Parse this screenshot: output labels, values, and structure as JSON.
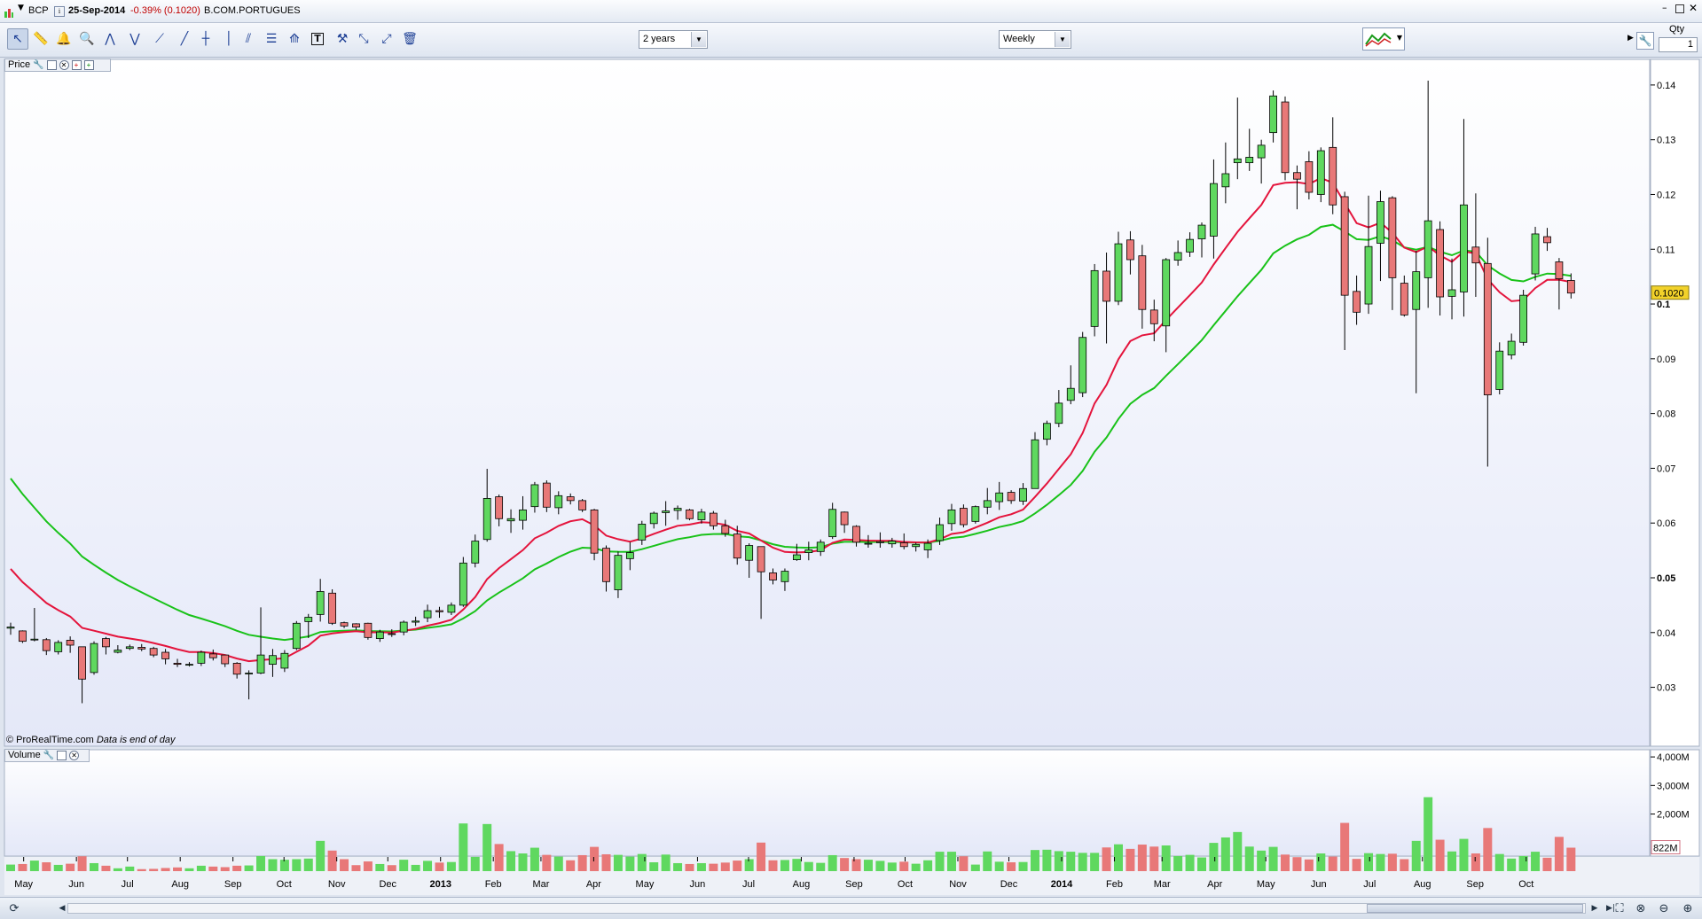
{
  "window": {
    "symbol": "BCP",
    "date": "25-Sep-2014",
    "change": "-0.39% (0.1020)",
    "name": "B.COM.PORTUGUES"
  },
  "toolbar": {
    "period": "2 years",
    "interval": "Weekly",
    "qty_label": "Qty",
    "qty_value": "1",
    "icons": [
      "pointer-icon",
      "ruler-icon",
      "alarm-bell-icon",
      "zoom-icon",
      "pattern-icon",
      "trend-pattern-icon",
      "trendline-icon",
      "line-icon",
      "horizontal-line-icon",
      "vertical-line-icon",
      "fibonacci-icon",
      "channel-icon",
      "regression-icon",
      "text-tool-icon",
      "hammer-icon",
      "extend-line-icon",
      "ray-icon",
      "trash-icon"
    ]
  },
  "price_panel": {
    "label": "Price",
    "credit": "© ProRealTime.com",
    "credit_note": "Data is end of day",
    "last_price_tag": "0.1020",
    "y_ticks": [
      "0.14",
      "0.13",
      "0.12",
      "0.11",
      "0.1",
      "0.09",
      "0.08",
      "0.07",
      "0.06",
      "0.05",
      "0.04",
      "0.03"
    ],
    "bold_ticks": [
      "0.1",
      "0.05"
    ]
  },
  "volume_panel": {
    "label": "Volume",
    "y_ticks": [
      "4,000M",
      "3,000M",
      "2,000M"
    ],
    "last_volume_tag": "822M"
  },
  "x_axis": {
    "labels": [
      "May",
      "Jun",
      "Jul",
      "Aug",
      "Sep",
      "Oct",
      "Nov",
      "Dec",
      "2013",
      "Feb",
      "Mar",
      "Apr",
      "May",
      "Jun",
      "Jul",
      "Aug",
      "Sep",
      "Oct",
      "Nov",
      "Dec",
      "2014",
      "Feb",
      "Mar",
      "Apr",
      "May",
      "Jun",
      "Jul",
      "Aug",
      "Sep",
      "Oct"
    ],
    "bold_labels": [
      "2013",
      "2014"
    ]
  },
  "colors": {
    "up": "#5fd85f",
    "down": "#e87878",
    "ma_short": "#e4143c",
    "ma_long": "#19c219",
    "background_top": "#ffffff",
    "background_bottom": "#e6eaf8",
    "tag": "#f2d22a"
  },
  "chart_data": {
    "type": "candlestick",
    "interval": "weekly",
    "ylim": [
      0.022,
      0.145
    ],
    "volume_ylim": [
      0,
      4500
    ],
    "volume_unit": "M",
    "x_start": "2012-04-27",
    "candles": [
      {
        "o": 0.0408,
        "h": 0.0418,
        "l": 0.0396,
        "c": 0.041,
        "v": 230
      },
      {
        "o": 0.0403,
        "h": 0.0404,
        "l": 0.0381,
        "c": 0.0384,
        "v": 250
      },
      {
        "o": 0.0388,
        "h": 0.0445,
        "l": 0.0384,
        "c": 0.0388,
        "v": 370
      },
      {
        "o": 0.0387,
        "h": 0.039,
        "l": 0.0359,
        "c": 0.0367,
        "v": 310
      },
      {
        "o": 0.0365,
        "h": 0.0386,
        "l": 0.036,
        "c": 0.0382,
        "v": 220
      },
      {
        "o": 0.0386,
        "h": 0.0393,
        "l": 0.0363,
        "c": 0.0377,
        "v": 260
      },
      {
        "o": 0.0374,
        "h": 0.0374,
        "l": 0.0271,
        "c": 0.0315,
        "v": 520
      },
      {
        "o": 0.0327,
        "h": 0.0384,
        "l": 0.0323,
        "c": 0.038,
        "v": 280
      },
      {
        "o": 0.0389,
        "h": 0.0392,
        "l": 0.036,
        "c": 0.0374,
        "v": 190
      },
      {
        "o": 0.0364,
        "h": 0.0377,
        "l": 0.0362,
        "c": 0.0368,
        "v": 100
      },
      {
        "o": 0.0371,
        "h": 0.0378,
        "l": 0.0368,
        "c": 0.0374,
        "v": 160
      },
      {
        "o": 0.0373,
        "h": 0.0379,
        "l": 0.0366,
        "c": 0.037,
        "v": 70
      },
      {
        "o": 0.0371,
        "h": 0.0374,
        "l": 0.0355,
        "c": 0.0359,
        "v": 80
      },
      {
        "o": 0.0364,
        "h": 0.037,
        "l": 0.0342,
        "c": 0.0352,
        "v": 110
      },
      {
        "o": 0.0344,
        "h": 0.0352,
        "l": 0.0337,
        "c": 0.0342,
        "v": 130
      },
      {
        "o": 0.0342,
        "h": 0.0346,
        "l": 0.0338,
        "c": 0.0342,
        "v": 100
      },
      {
        "o": 0.0344,
        "h": 0.0367,
        "l": 0.0339,
        "c": 0.0364,
        "v": 190
      },
      {
        "o": 0.0361,
        "h": 0.0369,
        "l": 0.0349,
        "c": 0.0354,
        "v": 160
      },
      {
        "o": 0.0359,
        "h": 0.0359,
        "l": 0.0337,
        "c": 0.0343,
        "v": 140
      },
      {
        "o": 0.0344,
        "h": 0.0346,
        "l": 0.0316,
        "c": 0.0324,
        "v": 190
      },
      {
        "o": 0.0325,
        "h": 0.0331,
        "l": 0.0278,
        "c": 0.0326,
        "v": 200
      },
      {
        "o": 0.0326,
        "h": 0.0446,
        "l": 0.0324,
        "c": 0.0359,
        "v": 530
      },
      {
        "o": 0.0342,
        "h": 0.037,
        "l": 0.0319,
        "c": 0.0358,
        "v": 420
      },
      {
        "o": 0.0335,
        "h": 0.0368,
        "l": 0.0328,
        "c": 0.0362,
        "v": 400
      },
      {
        "o": 0.0371,
        "h": 0.0421,
        "l": 0.0368,
        "c": 0.0417,
        "v": 420
      },
      {
        "o": 0.042,
        "h": 0.0434,
        "l": 0.039,
        "c": 0.0428,
        "v": 440
      },
      {
        "o": 0.0433,
        "h": 0.0498,
        "l": 0.042,
        "c": 0.0475,
        "v": 1060
      },
      {
        "o": 0.0472,
        "h": 0.0479,
        "l": 0.0414,
        "c": 0.0417,
        "v": 720
      },
      {
        "o": 0.0418,
        "h": 0.042,
        "l": 0.0408,
        "c": 0.0412,
        "v": 420
      },
      {
        "o": 0.0416,
        "h": 0.0417,
        "l": 0.0405,
        "c": 0.041,
        "v": 210
      },
      {
        "o": 0.0417,
        "h": 0.0418,
        "l": 0.0387,
        "c": 0.0391,
        "v": 340
      },
      {
        "o": 0.0389,
        "h": 0.0405,
        "l": 0.0383,
        "c": 0.0401,
        "v": 250
      },
      {
        "o": 0.0398,
        "h": 0.0406,
        "l": 0.0392,
        "c": 0.0397,
        "v": 210
      },
      {
        "o": 0.0401,
        "h": 0.0422,
        "l": 0.0395,
        "c": 0.0419,
        "v": 400
      },
      {
        "o": 0.0419,
        "h": 0.0429,
        "l": 0.0412,
        "c": 0.0421,
        "v": 220
      },
      {
        "o": 0.0427,
        "h": 0.0451,
        "l": 0.0419,
        "c": 0.044,
        "v": 360
      },
      {
        "o": 0.044,
        "h": 0.0447,
        "l": 0.0427,
        "c": 0.0438,
        "v": 300
      },
      {
        "o": 0.0437,
        "h": 0.0455,
        "l": 0.0432,
        "c": 0.045,
        "v": 320
      },
      {
        "o": 0.045,
        "h": 0.0538,
        "l": 0.0447,
        "c": 0.0527,
        "v": 1670
      },
      {
        "o": 0.0527,
        "h": 0.0579,
        "l": 0.0519,
        "c": 0.0567,
        "v": 500
      },
      {
        "o": 0.057,
        "h": 0.0699,
        "l": 0.0566,
        "c": 0.0645,
        "v": 1650
      },
      {
        "o": 0.0648,
        "h": 0.0652,
        "l": 0.0594,
        "c": 0.0608,
        "v": 950
      },
      {
        "o": 0.0604,
        "h": 0.0625,
        "l": 0.0582,
        "c": 0.0608,
        "v": 700
      },
      {
        "o": 0.0605,
        "h": 0.0649,
        "l": 0.0588,
        "c": 0.0624,
        "v": 620
      },
      {
        "o": 0.063,
        "h": 0.0675,
        "l": 0.0619,
        "c": 0.067,
        "v": 820
      },
      {
        "o": 0.0673,
        "h": 0.0678,
        "l": 0.062,
        "c": 0.0629,
        "v": 570
      },
      {
        "o": 0.0628,
        "h": 0.0658,
        "l": 0.0616,
        "c": 0.065,
        "v": 510
      },
      {
        "o": 0.0648,
        "h": 0.0654,
        "l": 0.0634,
        "c": 0.0641,
        "v": 380
      },
      {
        "o": 0.0641,
        "h": 0.0644,
        "l": 0.062,
        "c": 0.0624,
        "v": 560
      },
      {
        "o": 0.0624,
        "h": 0.0626,
        "l": 0.0532,
        "c": 0.0545,
        "v": 850
      },
      {
        "o": 0.0554,
        "h": 0.0559,
        "l": 0.0475,
        "c": 0.0493,
        "v": 590
      },
      {
        "o": 0.0478,
        "h": 0.0548,
        "l": 0.0463,
        "c": 0.0541,
        "v": 570
      },
      {
        "o": 0.0535,
        "h": 0.0565,
        "l": 0.0514,
        "c": 0.0546,
        "v": 510
      },
      {
        "o": 0.0569,
        "h": 0.0604,
        "l": 0.056,
        "c": 0.0598,
        "v": 600
      },
      {
        "o": 0.0599,
        "h": 0.0621,
        "l": 0.059,
        "c": 0.0618,
        "v": 310
      },
      {
        "o": 0.0619,
        "h": 0.064,
        "l": 0.0595,
        "c": 0.0622,
        "v": 580
      },
      {
        "o": 0.0623,
        "h": 0.0632,
        "l": 0.0606,
        "c": 0.0627,
        "v": 280
      },
      {
        "o": 0.0624,
        "h": 0.0626,
        "l": 0.0605,
        "c": 0.0608,
        "v": 250
      },
      {
        "o": 0.0606,
        "h": 0.0626,
        "l": 0.0599,
        "c": 0.062,
        "v": 280
      },
      {
        "o": 0.0618,
        "h": 0.0622,
        "l": 0.0588,
        "c": 0.0595,
        "v": 260
      },
      {
        "o": 0.0595,
        "h": 0.0606,
        "l": 0.0575,
        "c": 0.0581,
        "v": 300
      },
      {
        "o": 0.058,
        "h": 0.0595,
        "l": 0.0524,
        "c": 0.0536,
        "v": 370
      },
      {
        "o": 0.0532,
        "h": 0.0563,
        "l": 0.05,
        "c": 0.0559,
        "v": 420
      },
      {
        "o": 0.0557,
        "h": 0.0557,
        "l": 0.0425,
        "c": 0.0511,
        "v": 1000
      },
      {
        "o": 0.0509,
        "h": 0.0517,
        "l": 0.0488,
        "c": 0.0496,
        "v": 380
      },
      {
        "o": 0.0493,
        "h": 0.0517,
        "l": 0.0476,
        "c": 0.0512,
        "v": 390
      },
      {
        "o": 0.0533,
        "h": 0.0562,
        "l": 0.0531,
        "c": 0.0542,
        "v": 430
      },
      {
        "o": 0.0546,
        "h": 0.0566,
        "l": 0.0532,
        "c": 0.0551,
        "v": 320
      },
      {
        "o": 0.0548,
        "h": 0.057,
        "l": 0.054,
        "c": 0.0565,
        "v": 290
      },
      {
        "o": 0.0575,
        "h": 0.0637,
        "l": 0.0571,
        "c": 0.0625,
        "v": 560
      },
      {
        "o": 0.062,
        "h": 0.0621,
        "l": 0.0582,
        "c": 0.0597,
        "v": 460
      },
      {
        "o": 0.0594,
        "h": 0.0596,
        "l": 0.0557,
        "c": 0.0565,
        "v": 420
      },
      {
        "o": 0.0562,
        "h": 0.0578,
        "l": 0.0555,
        "c": 0.0563,
        "v": 400
      },
      {
        "o": 0.0564,
        "h": 0.0583,
        "l": 0.0555,
        "c": 0.0566,
        "v": 360
      },
      {
        "o": 0.0562,
        "h": 0.0573,
        "l": 0.0555,
        "c": 0.0567,
        "v": 300
      },
      {
        "o": 0.0564,
        "h": 0.0581,
        "l": 0.0552,
        "c": 0.0557,
        "v": 330
      },
      {
        "o": 0.0557,
        "h": 0.0564,
        "l": 0.0548,
        "c": 0.0561,
        "v": 260
      },
      {
        "o": 0.0551,
        "h": 0.057,
        "l": 0.0536,
        "c": 0.0563,
        "v": 380
      },
      {
        "o": 0.0568,
        "h": 0.061,
        "l": 0.056,
        "c": 0.0597,
        "v": 680
      },
      {
        "o": 0.0599,
        "h": 0.0635,
        "l": 0.0586,
        "c": 0.0624,
        "v": 680
      },
      {
        "o": 0.0627,
        "h": 0.0634,
        "l": 0.0592,
        "c": 0.0597,
        "v": 520
      },
      {
        "o": 0.0603,
        "h": 0.0632,
        "l": 0.0599,
        "c": 0.063,
        "v": 230
      },
      {
        "o": 0.0629,
        "h": 0.0664,
        "l": 0.0616,
        "c": 0.0641,
        "v": 690
      },
      {
        "o": 0.0639,
        "h": 0.0675,
        "l": 0.0624,
        "c": 0.0655,
        "v": 330
      },
      {
        "o": 0.0656,
        "h": 0.066,
        "l": 0.0635,
        "c": 0.0641,
        "v": 310
      },
      {
        "o": 0.064,
        "h": 0.0673,
        "l": 0.0633,
        "c": 0.0663,
        "v": 320
      },
      {
        "o": 0.0663,
        "h": 0.0766,
        "l": 0.0663,
        "c": 0.0752,
        "v": 740
      },
      {
        "o": 0.0753,
        "h": 0.0787,
        "l": 0.0742,
        "c": 0.0782,
        "v": 750
      },
      {
        "o": 0.0782,
        "h": 0.0843,
        "l": 0.0775,
        "c": 0.0819,
        "v": 700
      },
      {
        "o": 0.0824,
        "h": 0.0888,
        "l": 0.0817,
        "c": 0.0846,
        "v": 680
      },
      {
        "o": 0.0838,
        "h": 0.0949,
        "l": 0.083,
        "c": 0.0939,
        "v": 640
      },
      {
        "o": 0.0959,
        "h": 0.1073,
        "l": 0.0941,
        "c": 0.1061,
        "v": 640
      },
      {
        "o": 0.106,
        "h": 0.1094,
        "l": 0.0928,
        "c": 0.1005,
        "v": 830
      },
      {
        "o": 0.1005,
        "h": 0.1132,
        "l": 0.0998,
        "c": 0.111,
        "v": 940
      },
      {
        "o": 0.1117,
        "h": 0.1133,
        "l": 0.1054,
        "c": 0.1081,
        "v": 780
      },
      {
        "o": 0.1088,
        "h": 0.1108,
        "l": 0.0955,
        "c": 0.099,
        "v": 930
      },
      {
        "o": 0.0989,
        "h": 0.1008,
        "l": 0.0932,
        "c": 0.0964,
        "v": 860
      },
      {
        "o": 0.096,
        "h": 0.1084,
        "l": 0.0912,
        "c": 0.1081,
        "v": 900
      },
      {
        "o": 0.108,
        "h": 0.1116,
        "l": 0.107,
        "c": 0.1094,
        "v": 530
      },
      {
        "o": 0.1095,
        "h": 0.1131,
        "l": 0.1086,
        "c": 0.1118,
        "v": 570
      },
      {
        "o": 0.1119,
        "h": 0.1149,
        "l": 0.1085,
        "c": 0.1144,
        "v": 480
      },
      {
        "o": 0.1124,
        "h": 0.1264,
        "l": 0.1083,
        "c": 0.122,
        "v": 990
      },
      {
        "o": 0.1214,
        "h": 0.1295,
        "l": 0.1184,
        "c": 0.1238,
        "v": 1180
      },
      {
        "o": 0.1258,
        "h": 0.1377,
        "l": 0.1228,
        "c": 0.1265,
        "v": 1370
      },
      {
        "o": 0.1258,
        "h": 0.132,
        "l": 0.1243,
        "c": 0.1268,
        "v": 860
      },
      {
        "o": 0.1267,
        "h": 0.13,
        "l": 0.122,
        "c": 0.129,
        "v": 720
      },
      {
        "o": 0.1313,
        "h": 0.139,
        "l": 0.1295,
        "c": 0.138,
        "v": 850
      },
      {
        "o": 0.1369,
        "h": 0.1379,
        "l": 0.1226,
        "c": 0.124,
        "v": 580
      },
      {
        "o": 0.124,
        "h": 0.1253,
        "l": 0.1173,
        "c": 0.1228,
        "v": 490
      },
      {
        "o": 0.126,
        "h": 0.1279,
        "l": 0.1191,
        "c": 0.1204,
        "v": 410
      },
      {
        "o": 0.12,
        "h": 0.1286,
        "l": 0.1186,
        "c": 0.128,
        "v": 620
      },
      {
        "o": 0.1286,
        "h": 0.1341,
        "l": 0.1164,
        "c": 0.1181,
        "v": 510
      },
      {
        "o": 0.1196,
        "h": 0.1205,
        "l": 0.0916,
        "c": 0.1016,
        "v": 1690
      },
      {
        "o": 0.1023,
        "h": 0.1052,
        "l": 0.0962,
        "c": 0.0985,
        "v": 430
      },
      {
        "o": 0.1,
        "h": 0.1198,
        "l": 0.0982,
        "c": 0.1105,
        "v": 630
      },
      {
        "o": 0.1111,
        "h": 0.1207,
        "l": 0.1042,
        "c": 0.1187,
        "v": 600
      },
      {
        "o": 0.1194,
        "h": 0.1197,
        "l": 0.0989,
        "c": 0.1048,
        "v": 610
      },
      {
        "o": 0.1038,
        "h": 0.1052,
        "l": 0.0977,
        "c": 0.098,
        "v": 420
      },
      {
        "o": 0.099,
        "h": 0.1097,
        "l": 0.0837,
        "c": 0.1059,
        "v": 1060
      },
      {
        "o": 0.1048,
        "h": 0.1408,
        "l": 0.0993,
        "c": 0.1152,
        "v": 2590
      },
      {
        "o": 0.1136,
        "h": 0.1151,
        "l": 0.0979,
        "c": 0.1013,
        "v": 1100
      },
      {
        "o": 0.1014,
        "h": 0.1083,
        "l": 0.0972,
        "c": 0.1026,
        "v": 690
      },
      {
        "o": 0.1022,
        "h": 0.1338,
        "l": 0.0977,
        "c": 0.1181,
        "v": 1130
      },
      {
        "o": 0.1104,
        "h": 0.1202,
        "l": 0.1013,
        "c": 0.1075,
        "v": 620
      },
      {
        "o": 0.1074,
        "h": 0.1121,
        "l": 0.0703,
        "c": 0.0834,
        "v": 1510
      },
      {
        "o": 0.0844,
        "h": 0.093,
        "l": 0.0835,
        "c": 0.0914,
        "v": 600
      },
      {
        "o": 0.0907,
        "h": 0.0946,
        "l": 0.0899,
        "c": 0.0932,
        "v": 440
      },
      {
        "o": 0.093,
        "h": 0.1026,
        "l": 0.0924,
        "c": 0.1016,
        "v": 530
      },
      {
        "o": 0.1055,
        "h": 0.1141,
        "l": 0.1043,
        "c": 0.1128,
        "v": 680
      },
      {
        "o": 0.1123,
        "h": 0.1139,
        "l": 0.1097,
        "c": 0.1112,
        "v": 470
      },
      {
        "o": 0.1077,
        "h": 0.1084,
        "l": 0.099,
        "c": 0.1046,
        "v": 1200
      },
      {
        "o": 0.1043,
        "h": 0.1056,
        "l": 0.101,
        "c": 0.102,
        "v": 822
      }
    ],
    "ma_short_last": [
      0.1052
    ],
    "ma_long_last": [
      0.1029
    ]
  }
}
